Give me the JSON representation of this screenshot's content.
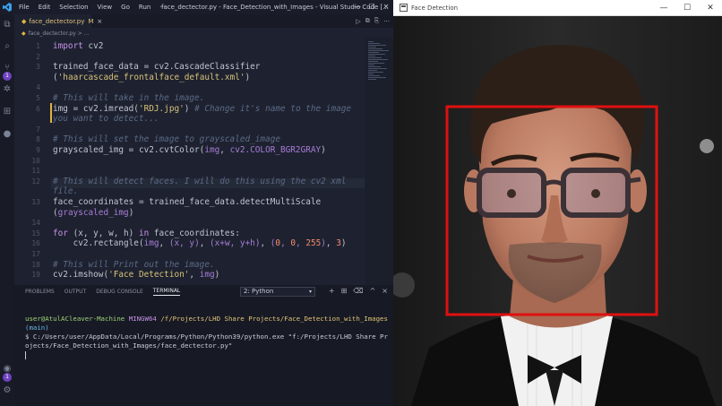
{
  "vscode": {
    "menu": [
      "File",
      "Edit",
      "Selection",
      "View",
      "Go",
      "Run",
      "···"
    ],
    "window_title": "face_dectector.py - Face_Detection_with_Images - Visual Studio Code [...",
    "tab": {
      "filename": "face_dectector.py",
      "modified": "M",
      "close": "×"
    },
    "breadcrumb": "face_dectector.py > ...",
    "editor_actions": [
      "▷",
      "⧉",
      "⎘",
      "···"
    ]
  },
  "code_lines": [
    {
      "n": "1",
      "html": "<span class='kw'>import</span> cv2"
    },
    {
      "n": "2",
      "html": ""
    },
    {
      "n": "3",
      "html": "trained_face_data = cv2.CascadeClassifier"
    },
    {
      "n": "",
      "html": "(<span class='str'>'haarcascade_frontalface_default.xml'</span>)"
    },
    {
      "n": "4",
      "html": ""
    },
    {
      "n": "5",
      "html": "<span class='cm'># This will take in the image.</span>"
    },
    {
      "n": "6",
      "html": "img = cv2.imread(<span class='str'>'RDJ.jpg'</span>) <span class='cm'># Change it's name to the image</span>"
    },
    {
      "n": "",
      "html": "<span class='cm'>you want to detect...</span>"
    },
    {
      "n": "7",
      "html": ""
    },
    {
      "n": "8",
      "html": "<span class='cm'># This will set the image to grayscaled_image</span>"
    },
    {
      "n": "9",
      "html": "grayscaled_img = cv2.cvtColor(<span class='pm'>img</span>, <span class='pm'>cv2.COLOR_BGR2GRAY</span>)"
    },
    {
      "n": "10",
      "html": ""
    },
    {
      "n": "11",
      "html": ""
    },
    {
      "n": "12",
      "html": "<span class='cm'># This will detect faces. I will do this using the cv2 xml</span>"
    },
    {
      "n": "",
      "html": "<span class='cm'>file.</span>"
    },
    {
      "n": "13",
      "html": "face_coordinates = trained_face_data.detectMultiScale"
    },
    {
      "n": "",
      "html": "(<span class='pm'>grayscaled_img</span>)"
    },
    {
      "n": "14",
      "html": ""
    },
    {
      "n": "15",
      "html": "<span class='kw'>for</span> (x, y, w, h) <span class='kw'>in</span> face_coordinates:"
    },
    {
      "n": "16",
      "html": "    cv2.rectangle(<span class='pm'>img</span>, <span class='pm'>(x, y)</span>, <span class='pm'>(x+w, y+h)</span>, <span class='pm'>(</span><span class='num'>0</span><span class='pm'>, </span><span class='num'>0</span><span class='pm'>, </span><span class='num'>255</span><span class='pm'>)</span>, <span class='num'>3</span>)"
    },
    {
      "n": "17",
      "html": ""
    },
    {
      "n": "18",
      "html": "<span class='cm'># This will Print out the image.</span>"
    },
    {
      "n": "19",
      "html": "cv2.imshow(<span class='str'>'Face Detection'</span>, <span class='pm'>img</span>)"
    }
  ],
  "panel": {
    "tabs": [
      "PROBLEMS",
      "OUTPUT",
      "DEBUG CONSOLE",
      "TERMINAL"
    ],
    "active_tab": "TERMINAL",
    "terminal_select": "2: Python",
    "actions": [
      "+",
      "⊞",
      "🗑",
      "^",
      "×"
    ],
    "terminal": {
      "user": "user@AtulACleaver-Machine",
      "shell": "MINGW64",
      "cwd": "/f/Projects/LHD Share Projects/Face_Detection_with_Images",
      "branch": "(main)",
      "command": "$ C:/Users/user/AppData/Local/Programs/Python/Python39/python.exe \"f:/Projects/LHD Share Projects/Face_Detection_with_Images/face_dectector.py\""
    }
  },
  "face_window": {
    "title": "Face Detection",
    "controls": [
      "—",
      "☐",
      "✕"
    ],
    "detection_color": "#e01010"
  }
}
